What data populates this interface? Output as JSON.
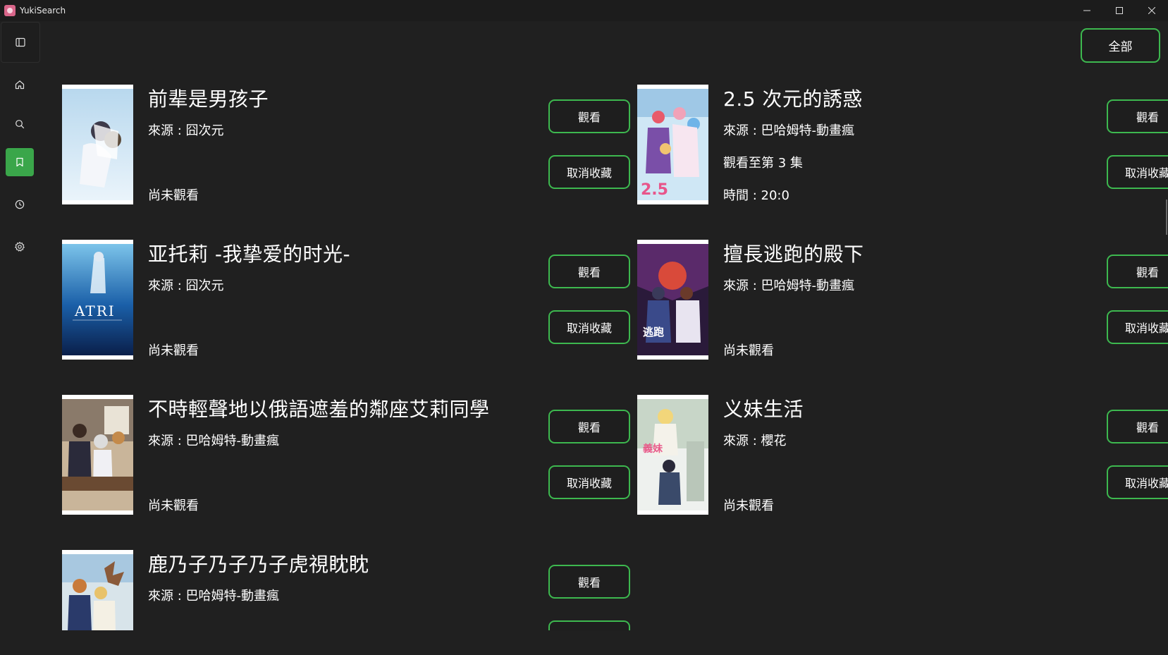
{
  "window": {
    "title": "YukiSearch",
    "controls": {
      "minimize": "—",
      "maximize": "☐",
      "close": "✕"
    }
  },
  "sidebar": {
    "items": [
      {
        "name": "home",
        "icon": "home-icon"
      },
      {
        "name": "search",
        "icon": "search-icon"
      },
      {
        "name": "favorites",
        "icon": "bookmark-icon",
        "active": true
      },
      {
        "name": "history",
        "icon": "clock-icon"
      },
      {
        "name": "settings",
        "icon": "gear-icon"
      }
    ]
  },
  "filter": {
    "label": "全部"
  },
  "buttons": {
    "watch": "觀看",
    "unfavorite": "取消收藏"
  },
  "cards": [
    {
      "title": "前辈是男孩子",
      "source": "來源 : 囧次元",
      "progress": "",
      "status": "尚未觀看"
    },
    {
      "title": "2.5 次元的誘惑",
      "source": "來源 : 巴哈姆特-動畫瘋",
      "progress": "觀看至第 3 集",
      "status": "時間 : 20:0"
    },
    {
      "title": "亚托莉 -我挚爱的时光-",
      "source": "來源 : 囧次元",
      "progress": "",
      "status": "尚未觀看"
    },
    {
      "title": "擅長逃跑的殿下",
      "source": "來源 : 巴哈姆特-動畫瘋",
      "progress": "",
      "status": "尚未觀看"
    },
    {
      "title": "不時輕聲地以俄語遮羞的鄰座艾莉同學",
      "source": "來源 : 巴哈姆特-動畫瘋",
      "progress": "",
      "status": "尚未觀看"
    },
    {
      "title": "义妹生活",
      "source": "來源 : 櫻花",
      "progress": "",
      "status": "尚未觀看"
    },
    {
      "title": "鹿乃子乃子乃子虎視眈眈",
      "source": "來源 : 巴哈姆特-動畫瘋",
      "progress": "",
      "status": ""
    }
  ],
  "colors": {
    "background": "#202020",
    "accent": "#3db84f",
    "active_nav": "#3aa64a",
    "text": "#ffffff"
  }
}
